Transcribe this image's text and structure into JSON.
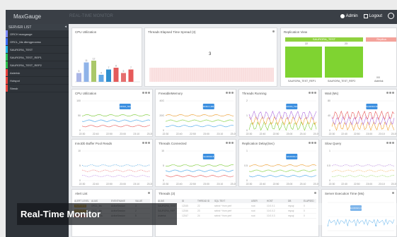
{
  "app": {
    "title": "MaxGauge",
    "breadcrumb": "REAL-TIME MONITOR"
  },
  "topbar": {
    "admin_label": "Admin",
    "logout_label": "Logout"
  },
  "sidebar": {
    "header": "SERVER LIST",
    "items": [
      {
        "label": "ORCH maxgauge",
        "color": "#7e8cff"
      },
      {
        "label": "ORCL_fds dbmgprocess",
        "color": "#3b6cf5"
      },
      {
        "label": "SAURORA_TEST",
        "color": "#1fb4e8"
      },
      {
        "label": "SAURORA_TEST_REP1",
        "color": "#27c45a"
      },
      {
        "label": "SAURORA_TEST_REP2",
        "color": "#2cbf4c"
      },
      {
        "label": "Asterisk",
        "color": "#e8433d"
      },
      {
        "label": "Hotspot",
        "color": "#e8433d"
      },
      {
        "label": "Stmsb",
        "color": "#e8433d"
      }
    ]
  },
  "panels": {
    "cpu_top": {
      "title": "CPU Utilization",
      "values": [
        5,
        11,
        12,
        4,
        7,
        8,
        5,
        7
      ],
      "colors": [
        "#aab6e6",
        "#8fb3e8",
        "#aac86a",
        "#62a8e6",
        "#2f8fcf",
        "#e35b5b",
        "#e56f6f",
        "#e65a5a"
      ]
    },
    "thread_elapsed": {
      "title": "Threads Elapsed Time Spread (3)",
      "value": "3"
    },
    "replication": {
      "title": "Replication View",
      "master": "SAURORA_TEST",
      "slaves": [
        "SAURORA_TEST_REP1",
        "SAURORA_TEST_REP2"
      ],
      "other": "Asterisk",
      "other_head": "Replica",
      "val_a": "22",
      "val_b": "23",
      "val_c": "0/0"
    },
    "cpu_util": {
      "title": "CPU Utilization",
      "xticks": [
        "22:30",
        "22:40",
        "22:50",
        "23:00",
        "23:10",
        "23:20"
      ],
      "yticks": [
        "100",
        "50",
        "0"
      ],
      "tip": "ASAURORA_TEST 12"
    },
    "freeable_memory": {
      "title": "FreeableMemory",
      "xticks": [
        "22:30",
        "22:40",
        "22:50",
        "23:00",
        "23:10",
        "23:20"
      ],
      "yticks": [
        "40G",
        "20G",
        "0"
      ],
      "tip": "SAURORA 4,984,608"
    },
    "threads_running": {
      "title": "Threads Running",
      "xticks": [
        "22:30",
        "22:40",
        "22:50",
        "23:00",
        "23:10",
        "23:20"
      ],
      "yticks": [
        "2",
        "1",
        "0"
      ],
      "tip": "SAURORA_TEST 1"
    },
    "wait": {
      "title": "Wait (Ms)",
      "xticks": [
        "22:30",
        "22:40",
        "22:50",
        "23:00",
        "23:10",
        "23:20"
      ],
      "yticks": [
        "80",
        "40",
        "0"
      ],
      "tip": "SAURORA 56"
    },
    "innodb": {
      "title": "InnoDb Buffer Pool Reads",
      "xticks": [
        "22:30",
        "22:40",
        "22:50",
        "23:00",
        "23:10",
        "23:20"
      ],
      "yticks": [
        "10",
        "5",
        "0"
      ]
    },
    "threads_connected": {
      "title": "Threads Connected",
      "xticks": [
        "22:30",
        "22:40",
        "22:50",
        "23:00",
        "23:10",
        "23:20"
      ],
      "yticks": [
        "10",
        "5",
        "0"
      ],
      "tip": "SAURORA 8"
    },
    "replication_delay": {
      "title": "Replication Delay(Sec)",
      "xticks": [
        "22:30",
        "22:40",
        "22:50",
        "23:00",
        "23:10",
        "23:20"
      ],
      "yticks": [
        "1",
        "0.5",
        "0"
      ],
      "tip": "SAURORA 0"
    },
    "slow_query": {
      "title": "Slow Query",
      "xticks": [
        "22:30",
        "22:40",
        "22:50",
        "23:00",
        "23:10",
        "23:20"
      ],
      "yticks": [
        "1",
        "0.5",
        "0"
      ]
    },
    "alert_list": {
      "title": "Alert List",
      "columns": [
        "ALERT LEVEL",
        "ALIAS",
        "EVENTNAME",
        "VALUE"
      ],
      "rows": [
        [
          "WARNING",
          "ORCL_fds",
          "ActiveSession",
          "3"
        ],
        [
          "WARNING",
          "ORCL_fds",
          "ActiveSession",
          "2"
        ],
        [
          "CRITICAL",
          "SAURORA",
          "ActiveSession",
          "5"
        ]
      ]
    },
    "threads": {
      "title": "Threads (3)",
      "columns": [
        "ALIAS",
        "ID",
        "THREAD ID",
        "SQL TEXT",
        "USER",
        "HOST",
        "DB",
        "ELAPSED"
      ],
      "rows": [
        [
          "SAURORA_TEST",
          "12345",
          "22",
          "select * from perf",
          "root",
          "10.0.0.1",
          "mysql",
          "0"
        ],
        [
          "SAURORA_REP",
          "12346",
          "23",
          "select * from perf",
          "root",
          "10.0.0.2",
          "mysql",
          "0"
        ],
        [
          "Asterisk",
          "12347",
          "24",
          "select * from perf",
          "root",
          "10.0.0.3",
          "mysql",
          "0"
        ]
      ]
    },
    "server_exec": {
      "title": "Server Execution Time (Ms)",
      "tip": "SAURORA 0.9"
    }
  },
  "banner": {
    "text": "Real-Time Monitor"
  }
}
